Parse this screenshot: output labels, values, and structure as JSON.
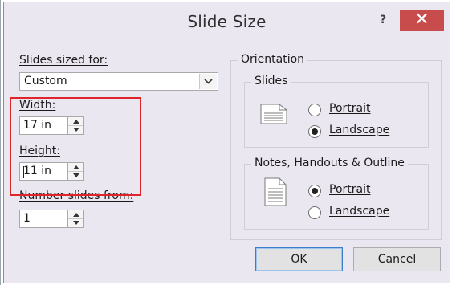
{
  "window": {
    "title": "Slide Size",
    "help_label": "?",
    "close_label": "✕"
  },
  "slides_sized_for": {
    "label": "Slides sized for:",
    "value": "Custom"
  },
  "width": {
    "label": "Width:",
    "value": "17 in"
  },
  "height": {
    "label": "Height:",
    "value": "11 in"
  },
  "number_slides_from": {
    "label": "Number slides from:",
    "value": "1"
  },
  "orientation": {
    "label": "Orientation",
    "slides": {
      "label": "Slides",
      "options": [
        {
          "label": "Portrait",
          "selected": false
        },
        {
          "label": "Landscape",
          "selected": true
        }
      ]
    },
    "notes": {
      "label": "Notes, Handouts & Outline",
      "options": [
        {
          "label": "Portrait",
          "selected": true
        },
        {
          "label": "Landscape",
          "selected": false
        }
      ]
    }
  },
  "buttons": {
    "ok": "OK",
    "cancel": "Cancel"
  },
  "colors": {
    "dialog_bg": "#ebe7f1",
    "close_button": "#c94c4c",
    "highlight_box": "#e0242b"
  },
  "icons": [
    "help-icon",
    "close-icon",
    "dropdown-arrow-icon",
    "spin-up-icon",
    "spin-down-icon",
    "landscape-page-icon",
    "portrait-page-icon"
  ]
}
